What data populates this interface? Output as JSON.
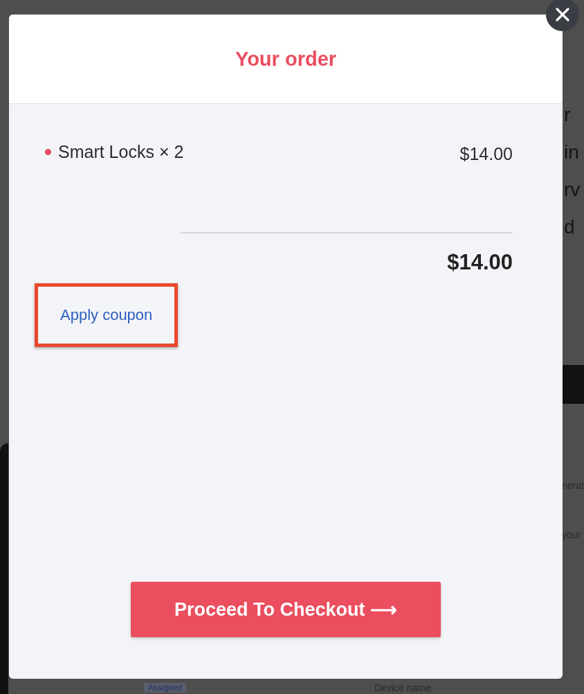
{
  "background": {
    "fragments": [
      "r",
      "in",
      "rv",
      "d"
    ],
    "side_labels": [
      "nerat",
      "your"
    ],
    "badge": "Assigned",
    "device_name": "Device name"
  },
  "modal": {
    "title": "Your order",
    "items": [
      {
        "name": "Smart Locks",
        "quantity": "× 2",
        "price": "$14.00",
        "color": "#e94e5f"
      }
    ],
    "total": "$14.00",
    "coupon": {
      "label": "Apply coupon",
      "highlighted": true
    },
    "checkout_button": "Proceed To Checkout ⟶"
  }
}
